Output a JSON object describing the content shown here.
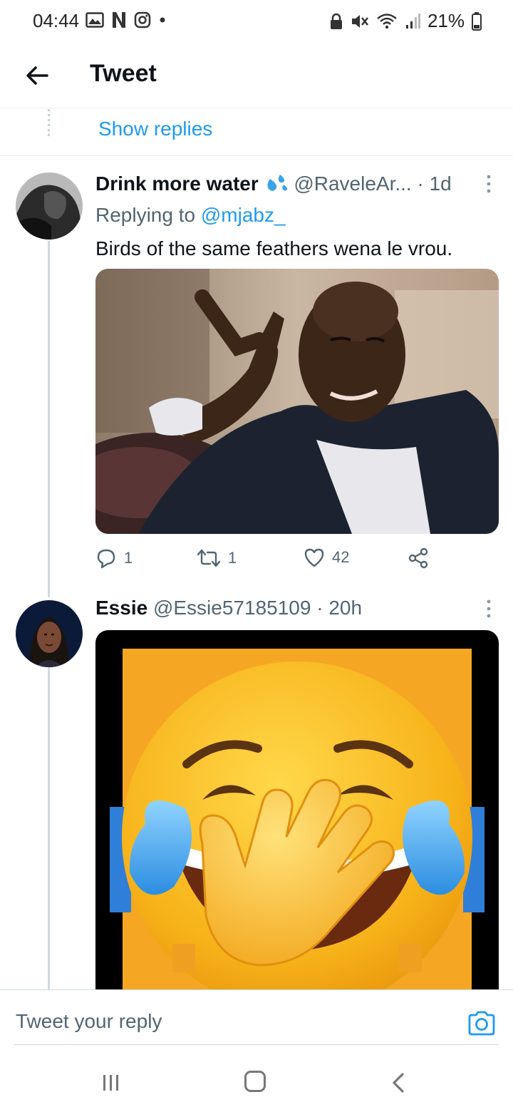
{
  "status": {
    "time": "04:44",
    "battery": "21%",
    "left_icons": [
      "gallery-icon",
      "netflix-icon",
      "instagram-icon",
      "dot-icon"
    ],
    "right_icons": [
      "lock-icon",
      "mute-icon",
      "wifi-icon",
      "signal-icon",
      "battery-icon"
    ]
  },
  "header": {
    "title": "Tweet"
  },
  "thread": {
    "show_replies": "Show replies"
  },
  "tweets": [
    {
      "name": "Drink more water",
      "handle": "@RaveleAr...",
      "separator": "·",
      "age": "1d",
      "replying_prefix": "Replying to",
      "replying_to": "@mjabz_",
      "text": "Birds of the same feathers wena le vrou.",
      "actions": {
        "replies": "1",
        "retweets": "1",
        "likes": "42"
      }
    },
    {
      "name": "Essie",
      "handle": "@Essie57185109",
      "separator": "·",
      "age": "20h"
    }
  ],
  "composer": {
    "placeholder": "Tweet your reply"
  },
  "colors": {
    "accent": "#1d9bf0",
    "text": "#0f1419",
    "muted": "#536471",
    "divider": "#e6ecf0"
  }
}
